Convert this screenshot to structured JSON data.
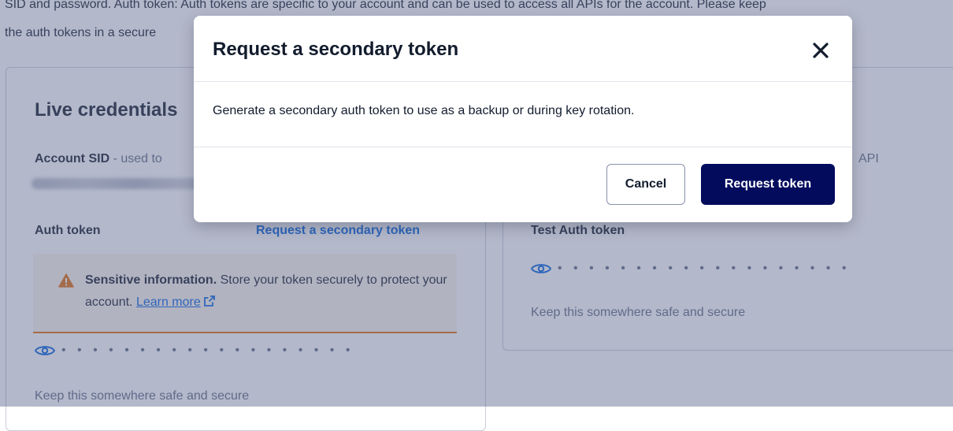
{
  "intro": {
    "line1": "SID and password. Auth token: Auth tokens are specific to your account and can be used to access all APIs for the account. Please keep",
    "line2": "the auth tokens in a secure"
  },
  "live": {
    "title": "Live credentials",
    "account_sid_label": "Account SID",
    "account_sid_hint": " - used to",
    "auth_token_label": "Auth token",
    "request_link": "Request a secondary token",
    "warning_bold": "Sensitive information.",
    "warning_text": " Store your token securely to protect your account. ",
    "learn_more": "Learn more",
    "masked_token": "• • • • • • • • • • • • • • • • • • •",
    "keep_safe": "Keep this somewhere safe and secure"
  },
  "test": {
    "api_fragment": "API",
    "auth_token_label": "Test Auth token",
    "masked_token": "• • • • • • • • • • • • • • • • • • •",
    "keep_safe": "Keep this somewhere safe and secure"
  },
  "modal": {
    "title": "Request a secondary token",
    "body": "Generate a secondary auth token to use as a backup or during key rotation.",
    "cancel_label": "Cancel",
    "confirm_label": "Request token"
  },
  "icons": {
    "close": "close-icon",
    "warning": "warning-icon",
    "external_link": "external-link-icon",
    "eye": "eye-icon"
  },
  "colors": {
    "primary_button": "#030b5d",
    "link": "#0263e0",
    "warning": "#e26e0c",
    "overlay": "#606b91"
  }
}
